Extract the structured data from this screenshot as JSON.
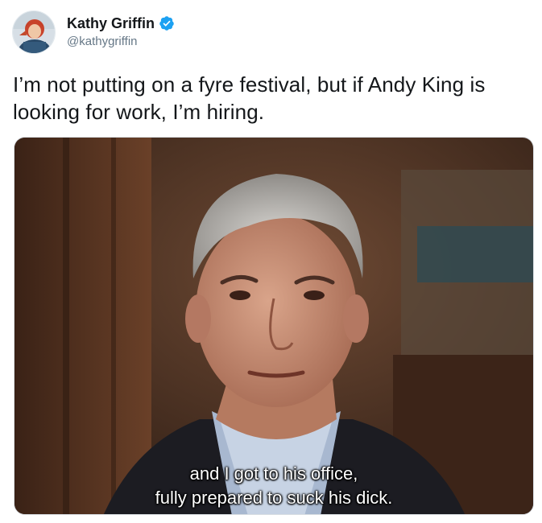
{
  "tweet": {
    "author": {
      "display_name": "Kathy Griffin",
      "handle": "@kathygriffin",
      "verified": true,
      "verified_icon": "verified-badge-icon",
      "verified_color": "#1da1f2"
    },
    "text": "I’m not putting on a fyre festival, but if Andy King is looking for work, I’m hiring.",
    "media": {
      "subtitle_line1": "and I got to his office,",
      "subtitle_line2": "fully prepared to suck his dick."
    }
  }
}
